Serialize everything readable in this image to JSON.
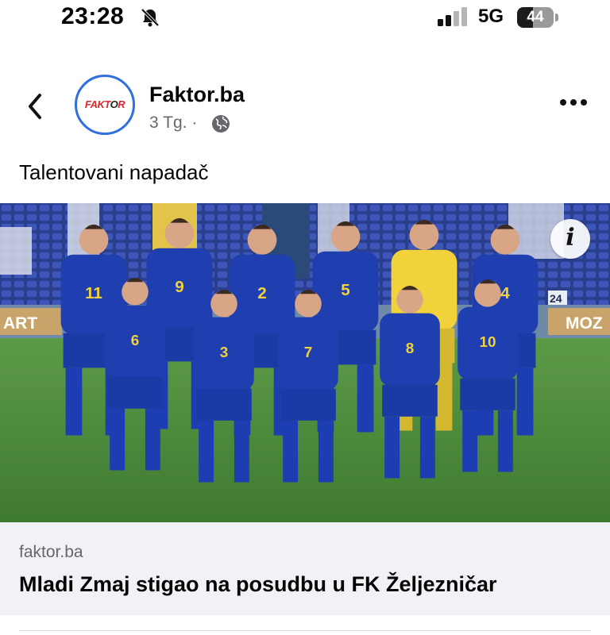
{
  "status_bar": {
    "time": "23:28",
    "network": "5G",
    "battery_level": "44",
    "battery_fraction": 0.44,
    "icons": [
      "bell-slash-icon",
      "signal-icon",
      "battery-icon"
    ]
  },
  "post": {
    "page_name": "Faktor.ba",
    "avatar_logo_text": "FAKTOR",
    "time_ago": "3 Tg.",
    "separator": "·",
    "caption": "Talentovani napadač",
    "player_numbers": [
      "11",
      "9",
      "2",
      "5",
      "4",
      "6",
      "3",
      "7",
      "8",
      "10"
    ],
    "stadium_board_left": "ART",
    "stadium_board_right": "MOZ",
    "stadium_board_number": "24",
    "info_glyph": "i"
  },
  "link_preview": {
    "domain": "faktor.ba",
    "title": "Mladi Zmaj stigao na posudbu u FK Željezničar"
  },
  "colors": {
    "kit_blue": "#1f3fb0",
    "kit_yellow": "#f2d23a",
    "pitch_green": "#4f8a3c",
    "accent_blue": "#2f6fe0",
    "meta_gray": "#65676b"
  }
}
